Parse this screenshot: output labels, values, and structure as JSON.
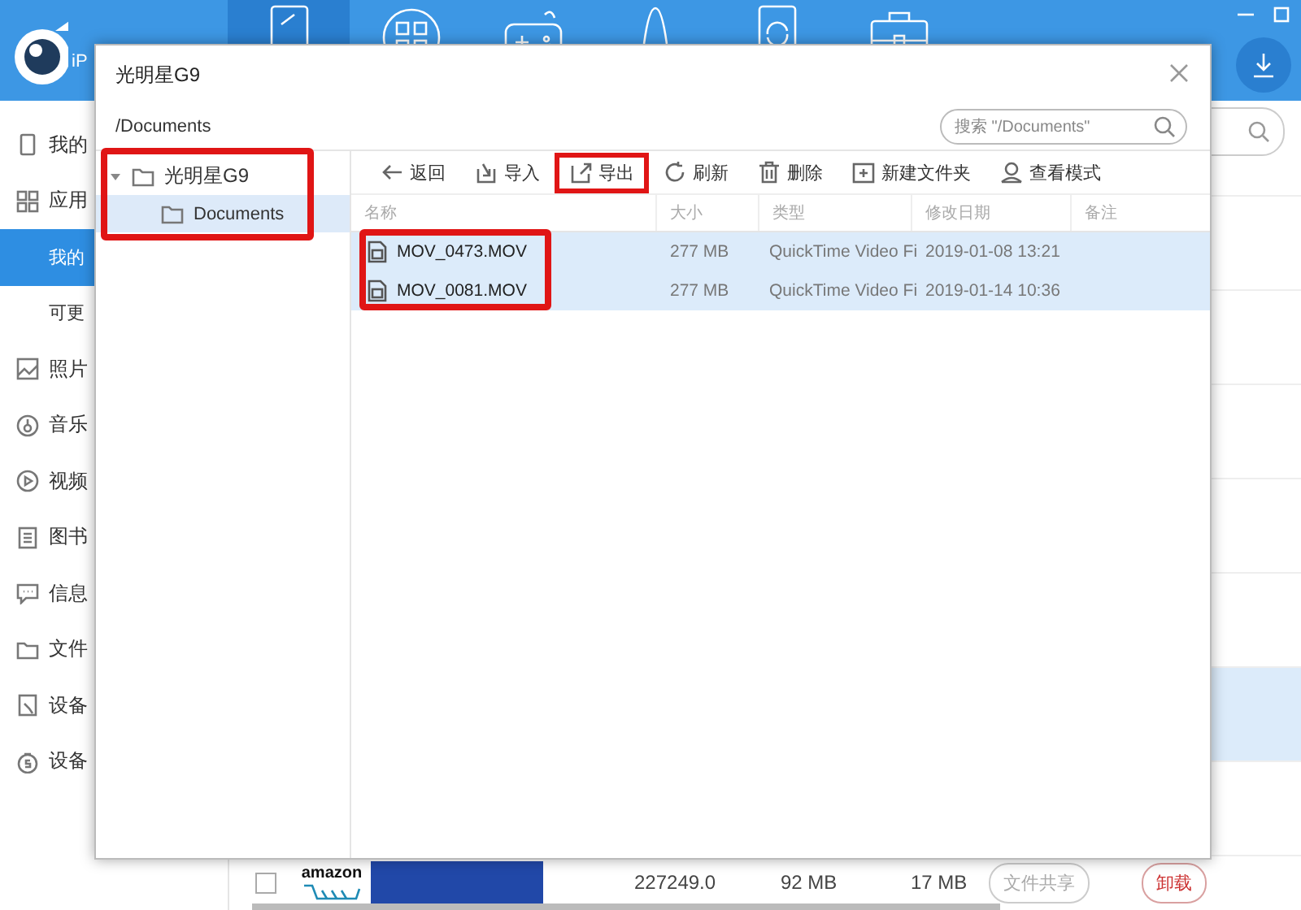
{
  "app": {
    "logo_text": "iP",
    "nav": [
      {
        "kind": "phone",
        "selected": true
      },
      {
        "kind": "apps",
        "selected": false
      },
      {
        "kind": "game",
        "selected": false
      },
      {
        "kind": "bell",
        "selected": false
      },
      {
        "kind": "sync",
        "selected": false
      },
      {
        "kind": "toolbox",
        "selected": false
      }
    ],
    "sidebar": [
      {
        "label": "我的",
        "kind": "phone",
        "selected": false
      },
      {
        "label": "应用",
        "kind": "apps",
        "selected": false
      },
      {
        "label": "我的",
        "kind": "sub",
        "selected": true
      },
      {
        "label": "可更",
        "kind": "sub",
        "selected": false
      },
      {
        "label": "照片",
        "kind": "photo",
        "selected": false
      },
      {
        "label": "音乐",
        "kind": "music",
        "selected": false
      },
      {
        "label": "视频",
        "kind": "video",
        "selected": false
      },
      {
        "label": "图书",
        "kind": "book",
        "selected": false
      },
      {
        "label": "信息",
        "kind": "message",
        "selected": false
      },
      {
        "label": "文件",
        "kind": "folder",
        "selected": false
      },
      {
        "label": "设备",
        "kind": "device",
        "selected": false
      },
      {
        "label": "设备",
        "kind": "coin",
        "selected": false
      }
    ],
    "list_rows": [
      {
        "selected": false
      },
      {
        "selected": false
      },
      {
        "selected": false
      },
      {
        "selected": false
      },
      {
        "selected": false
      },
      {
        "selected": true
      },
      {
        "selected": false
      }
    ],
    "app_row": {
      "checked": false,
      "logo": "amazon",
      "version": "227249.0",
      "size": "92 MB",
      "data": "17 MB",
      "share_button": "文件共享",
      "uninstall_button": "卸载"
    }
  },
  "dialog": {
    "title": "光明星G9",
    "path": "/Documents",
    "search": {
      "placeholder": "搜索 \"/Documents\""
    },
    "tree_highlighted": true,
    "tree": [
      {
        "label": "光明星G9",
        "expanded": true,
        "selected": false,
        "children": [
          {
            "label": "Documents",
            "selected": true
          }
        ]
      }
    ],
    "toolbar": [
      {
        "label": "返回",
        "kind": "back",
        "highlighted": false
      },
      {
        "label": "导入",
        "kind": "import",
        "highlighted": false
      },
      {
        "label": "导出",
        "kind": "export",
        "highlighted": true
      },
      {
        "label": "刷新",
        "kind": "refresh",
        "highlighted": false
      },
      {
        "label": "删除",
        "kind": "delete",
        "highlighted": false
      },
      {
        "label": "新建文件夹",
        "kind": "newfolder",
        "highlighted": false
      },
      {
        "label": "查看模式",
        "kind": "view",
        "highlighted": false
      }
    ],
    "columns": [
      "名称",
      "大小",
      "类型",
      "修改日期",
      "备注"
    ],
    "files_highlighted": true,
    "files": [
      {
        "name": "MOV_0473.MOV",
        "size": "277 MB",
        "type": "QuickTime Video Fi",
        "modified": "2019-01-08 13:21",
        "selected": true
      },
      {
        "name": "MOV_0081.MOV",
        "size": "277 MB",
        "type": "QuickTime Video Fi",
        "modified": "2019-01-14 10:36",
        "selected": true
      }
    ]
  }
}
